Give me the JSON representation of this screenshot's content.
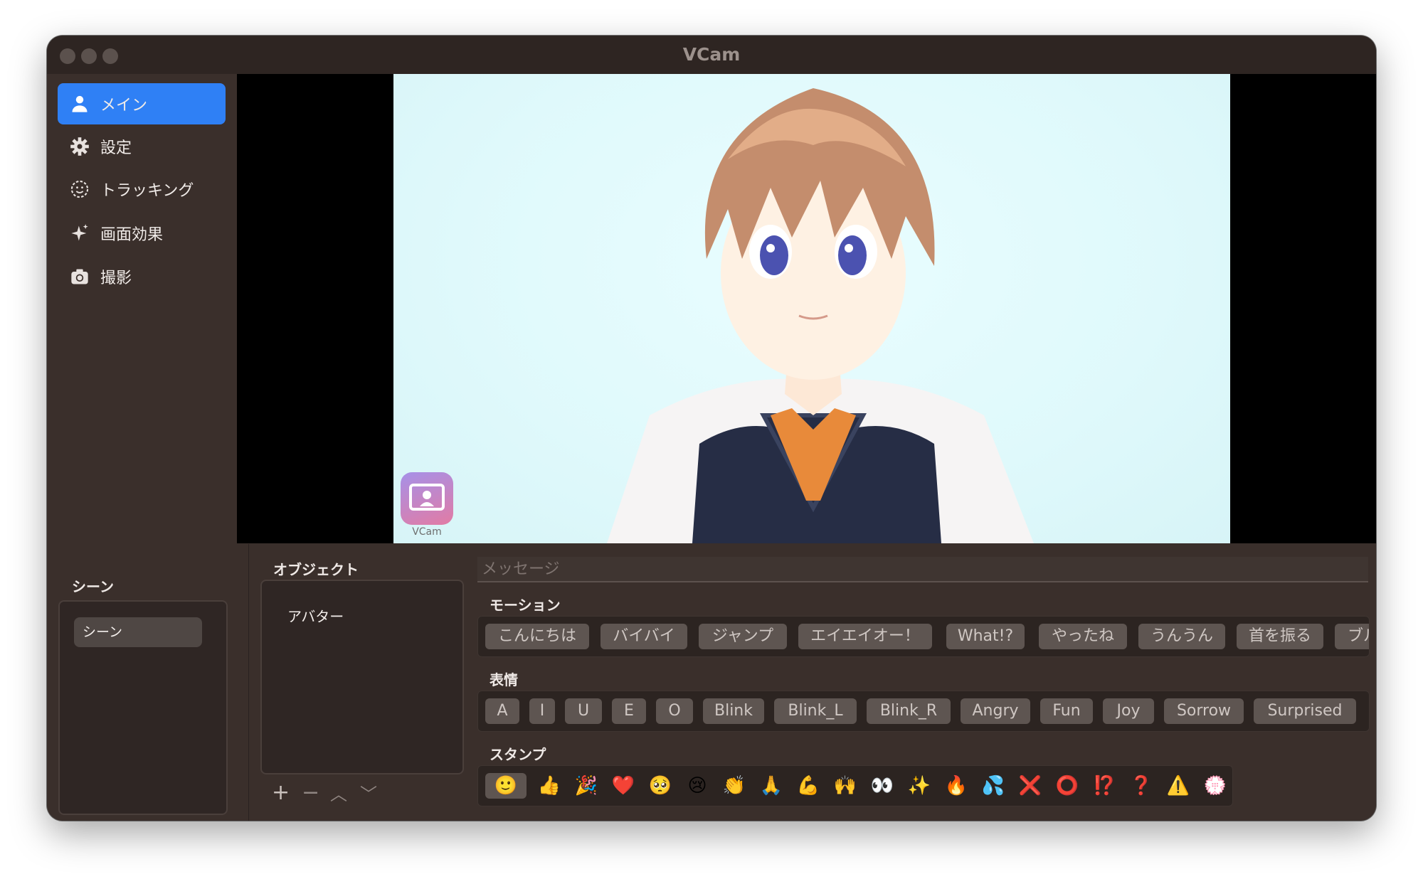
{
  "window": {
    "title": "VCam"
  },
  "sidebar": {
    "items": [
      {
        "label": "メイン",
        "icon": "person-icon",
        "active": true
      },
      {
        "label": "設定",
        "icon": "gear-icon"
      },
      {
        "label": "トラッキング",
        "icon": "face-icon"
      },
      {
        "label": "画面効果",
        "icon": "sparkle-icon"
      },
      {
        "label": "撮影",
        "icon": "camera-icon"
      }
    ],
    "scene_section": {
      "title": "シーン",
      "items": [
        "シーン"
      ]
    }
  },
  "preview": {
    "watermark_text": "VCam"
  },
  "objects": {
    "title": "オブジェクト",
    "items": [
      "アバター"
    ]
  },
  "controls": {
    "add": "+",
    "remove": "−",
    "up": "︿",
    "down": "﹀"
  },
  "message": {
    "placeholder": "メッセージ"
  },
  "motion": {
    "title": "モーション",
    "buttons": [
      "こんにちは",
      "バイバイ",
      "ジャンプ",
      "エイエイオー！",
      "What!?",
      "やったね",
      "うんうん",
      "首を振る",
      "ブル"
    ]
  },
  "expression": {
    "title": "表情",
    "buttons": [
      "A",
      "I",
      "U",
      "E",
      "O",
      "Blink",
      "Blink_L",
      "Blink_R",
      "Angry",
      "Fun",
      "Joy",
      "Sorrow",
      "Surprised"
    ]
  },
  "stamps": {
    "title": "スタンプ",
    "items": [
      "🙂",
      "👍",
      "🎉",
      "❤️",
      "🥺",
      "😢",
      "👏",
      "🙏",
      "💪",
      "🙌",
      "👀",
      "✨",
      "🔥",
      "💦",
      "❌",
      "⭕",
      "⁉️",
      "❓",
      "⚠️",
      "💮"
    ]
  },
  "colors": {
    "accent": "#2f80f5",
    "window_bg": "#3a2f2b",
    "preview_bg": "#dff9fb"
  }
}
